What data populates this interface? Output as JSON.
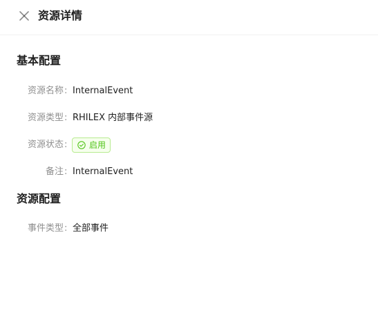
{
  "drawer": {
    "title": "资源详情",
    "close_icon": "close-icon"
  },
  "basic_config": {
    "heading": "基本配置",
    "name": {
      "label": "资源名称",
      "value": "InternalEvent"
    },
    "type": {
      "label": "资源类型",
      "value": "RHILEX 内部事件源"
    },
    "status": {
      "label": "资源状态",
      "value": "启用",
      "icon": "check-circle-icon",
      "color": "#52c41a"
    },
    "remark": {
      "label": "备注",
      "value": "InternalEvent"
    }
  },
  "resource_config": {
    "heading": "资源配置",
    "event_type": {
      "label": "事件类型",
      "value": "全部事件"
    }
  },
  "colon": ":"
}
